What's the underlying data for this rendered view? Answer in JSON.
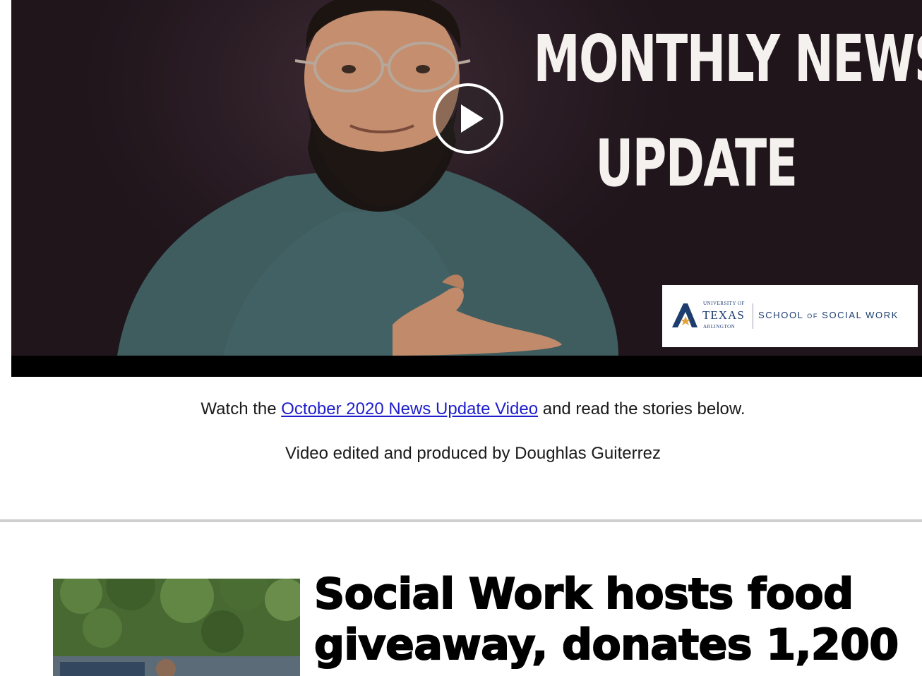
{
  "video": {
    "headline_line1": "MONTHLY NEWS",
    "headline_line2": "UPDATE",
    "logo": {
      "small_top": "UNIVERSITY OF",
      "texas": "TEXAS",
      "small_bottom": "ARLINGTON",
      "school_part1": "SCHOOL",
      "school_of": "OF",
      "school_part2": "SOCIAL WORK"
    }
  },
  "caption": {
    "prefix": "Watch the",
    "link_text": "October 2020 News Update Video",
    "suffix": "and read the stories below.",
    "credit": "Video edited and produced by Doughlas Guiterrez"
  },
  "story": {
    "title": "Social Work hosts food giveaway, donates 1,200"
  },
  "colors": {
    "link": "#1e1ecc",
    "logo_navy": "#1c3d6e",
    "logo_star": "#e2a13a",
    "divider": "#cfcfcf"
  },
  "icons": {
    "play": "play-icon",
    "logo_mark": "uta-a-logo-icon"
  }
}
